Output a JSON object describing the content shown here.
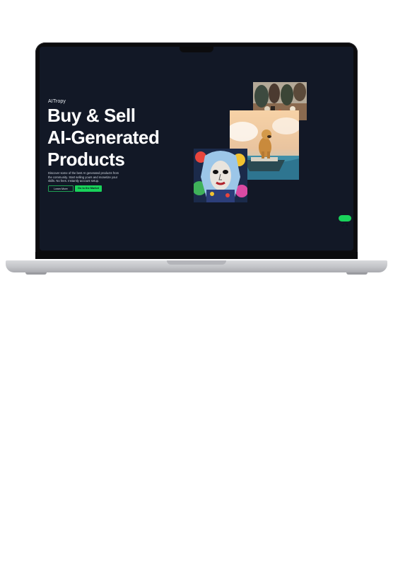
{
  "brand": "AITropy",
  "headline": {
    "line1": "Buy & Sell",
    "line2": "AI-Generated",
    "line3": "Products"
  },
  "description": "Discover some of the best AI generated products from the community. Start selling yours and monetize your skills. No fees. Instantly account setup.",
  "buttons": {
    "learn_more": "Learn More",
    "go_to_market": "Go to the Market"
  },
  "images": {
    "top": "mushroom-forest-artwork",
    "middle": "dog-on-boat-artwork",
    "bottom": "abstract-woman-portrait-artwork"
  },
  "chat_widget": {
    "icon": "chat-toggle-icon"
  },
  "colors": {
    "screen_bg": "#121826",
    "accent": "#19d35a",
    "text": "#ffffff"
  }
}
